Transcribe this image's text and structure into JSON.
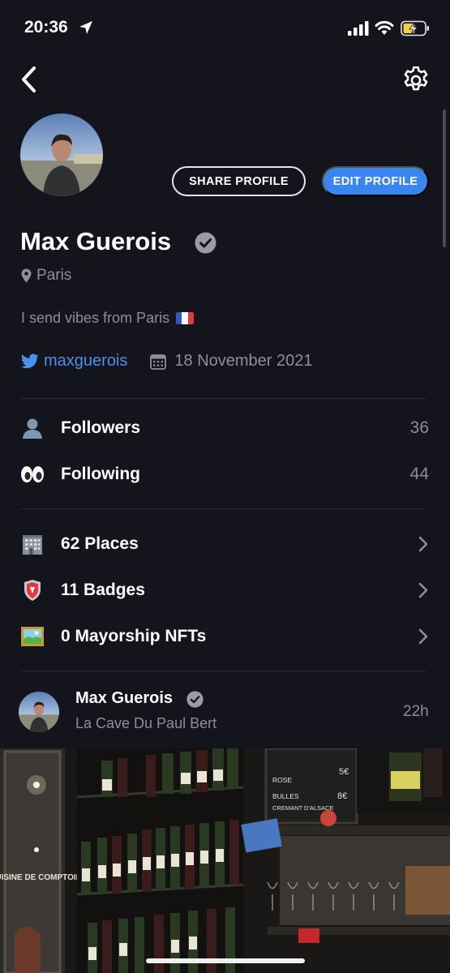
{
  "status_bar": {
    "time": "20:36"
  },
  "profile": {
    "name": "Max Guerois",
    "location": "Paris",
    "bio": "I send vibes from Paris",
    "twitter_handle": "maxguerois",
    "join_date": "18 November 2021",
    "share_label": "SHARE PROFILE",
    "edit_label": "EDIT PROFILE"
  },
  "social": [
    {
      "icon": "bust-silhouette-icon",
      "label": "Followers",
      "count": "36"
    },
    {
      "icon": "eyes-icon",
      "label": "Following",
      "count": "44"
    }
  ],
  "collections": [
    {
      "icon": "office-building-icon",
      "label": "62 Places"
    },
    {
      "icon": "badge-shield-icon",
      "label": "11 Badges"
    },
    {
      "icon": "framed-picture-icon",
      "label": "0 Mayorship NFTs"
    }
  ],
  "post": {
    "author": "Max Guerois",
    "venue": "La Cave Du Paul Bert",
    "time": "22h",
    "photo_text": {
      "sign": "CUISINE DE COMPTOIR",
      "board_line_1": "ROSE",
      "board_line_2": "BULLES",
      "board_line_3": "CREMANT D'ALSACE",
      "board_price_1": "5€",
      "board_price_2": "8€"
    }
  },
  "colors": {
    "background": "#14141d",
    "accent_blue": "#3a86f0",
    "twitter_blue": "#4a90f0",
    "secondary_text": "#8e8e99",
    "divider": "#2d2d38"
  }
}
